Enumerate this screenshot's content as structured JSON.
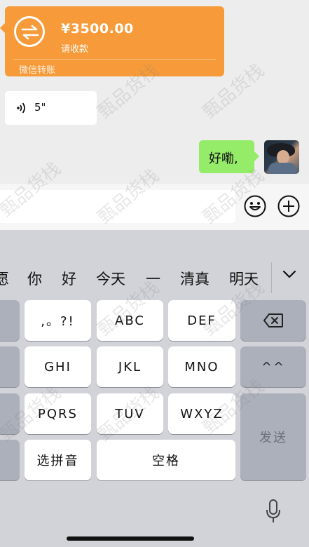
{
  "transfer": {
    "amount": "¥3500.00",
    "status": "请收款",
    "footer": "微信转账"
  },
  "voice_message": {
    "duration": "5\""
  },
  "outgoing_message": {
    "text": "好嘞,"
  },
  "watermark_text": "甄品货栈",
  "candidates": [
    "愿",
    "你",
    "好",
    "今天",
    "一",
    "清真",
    "明天"
  ],
  "keys": {
    "punct": ",。?!",
    "abc": "ABC",
    "def": "DEF",
    "ghi": "GHI",
    "jkl": "JKL",
    "mno": "MNO",
    "pqrs": "PQRS",
    "tuv": "TUV",
    "wxyz": "WXYZ",
    "pinyin": "选拼音",
    "space": "空格",
    "emoticon": "^^",
    "send": "发送"
  },
  "colors": {
    "transfer_bg": "#f79b3a",
    "outgoing_bubble": "#95ec69",
    "keyboard_bg": "#d1d3d9"
  }
}
